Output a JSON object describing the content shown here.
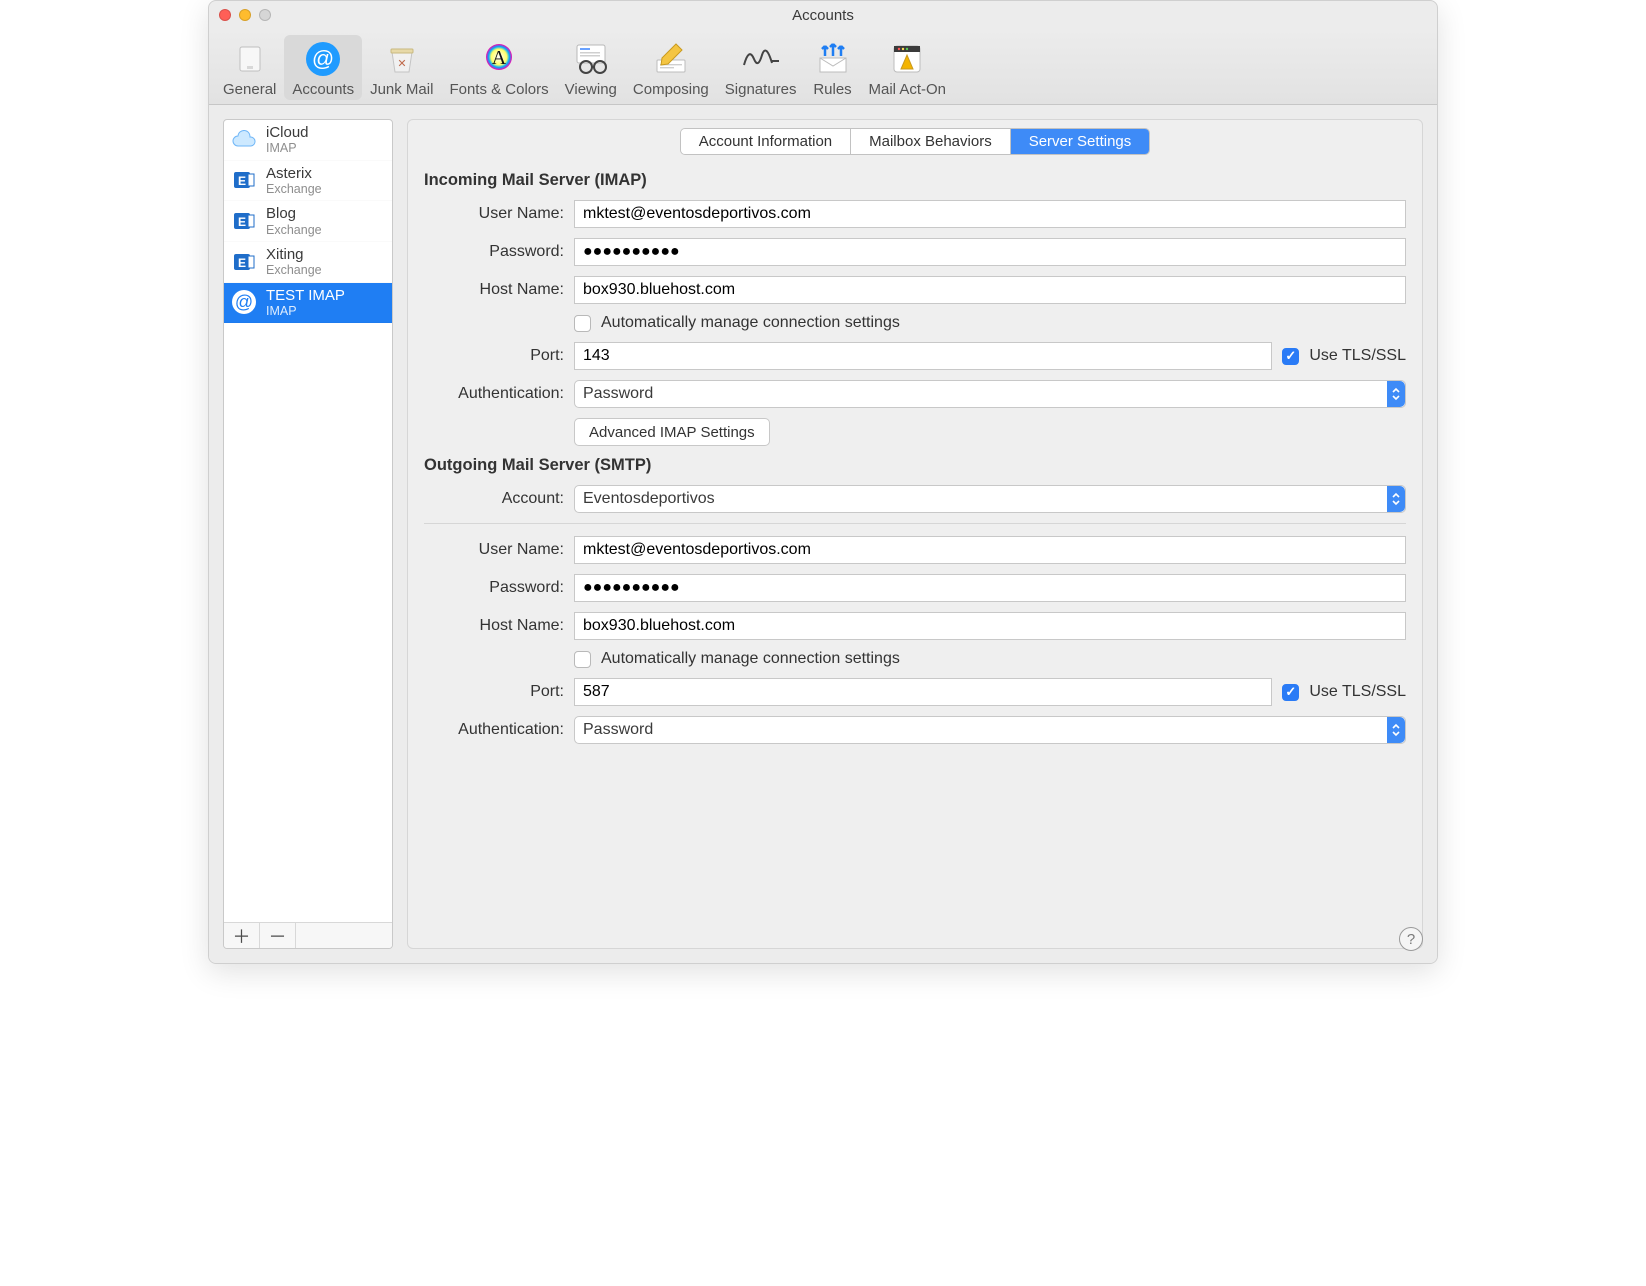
{
  "window_title": "Accounts",
  "toolbar": [
    {
      "label": "General"
    },
    {
      "label": "Accounts"
    },
    {
      "label": "Junk Mail"
    },
    {
      "label": "Fonts & Colors"
    },
    {
      "label": "Viewing"
    },
    {
      "label": "Composing"
    },
    {
      "label": "Signatures"
    },
    {
      "label": "Rules"
    },
    {
      "label": "Mail Act-On"
    }
  ],
  "toolbar_active_index": 1,
  "sidebar": {
    "accounts": [
      {
        "name": "iCloud",
        "type": "IMAP",
        "icon": "icloud"
      },
      {
        "name": "Asterix",
        "type": "Exchange",
        "icon": "exchange"
      },
      {
        "name": "Blog",
        "type": "Exchange",
        "icon": "exchange"
      },
      {
        "name": "Xiting",
        "type": "Exchange",
        "icon": "exchange"
      },
      {
        "name": "TEST IMAP",
        "type": "IMAP",
        "icon": "at"
      }
    ],
    "selected_index": 4
  },
  "tabs": {
    "items": [
      "Account Information",
      "Mailbox Behaviors",
      "Server Settings"
    ],
    "active_index": 2
  },
  "incoming": {
    "heading": "Incoming Mail Server (IMAP)",
    "labels": {
      "user_name": "User Name:",
      "password": "Password:",
      "host_name": "Host Name:",
      "auto": "Automatically manage connection settings",
      "port": "Port:",
      "tls": "Use TLS/SSL",
      "auth": "Authentication:",
      "advanced": "Advanced IMAP Settings"
    },
    "user_name": "mktest@eventosdeportivos.com",
    "password_mask": "●●●●●●●●●●",
    "host_name": "box930.bluehost.com",
    "auto_manage": false,
    "port": "143",
    "use_tls": true,
    "auth": "Password"
  },
  "outgoing": {
    "heading": "Outgoing Mail Server (SMTP)",
    "labels": {
      "account": "Account:",
      "user_name": "User Name:",
      "password": "Password:",
      "host_name": "Host Name:",
      "auto": "Automatically manage connection settings",
      "port": "Port:",
      "tls": "Use TLS/SSL",
      "auth": "Authentication:"
    },
    "account": "Eventosdeportivos",
    "user_name": "mktest@eventosdeportivos.com",
    "password_mask": "●●●●●●●●●●",
    "host_name": "box930.bluehost.com",
    "auto_manage": false,
    "port": "587",
    "use_tls": true,
    "auth": "Password"
  },
  "help_glyph": "?"
}
